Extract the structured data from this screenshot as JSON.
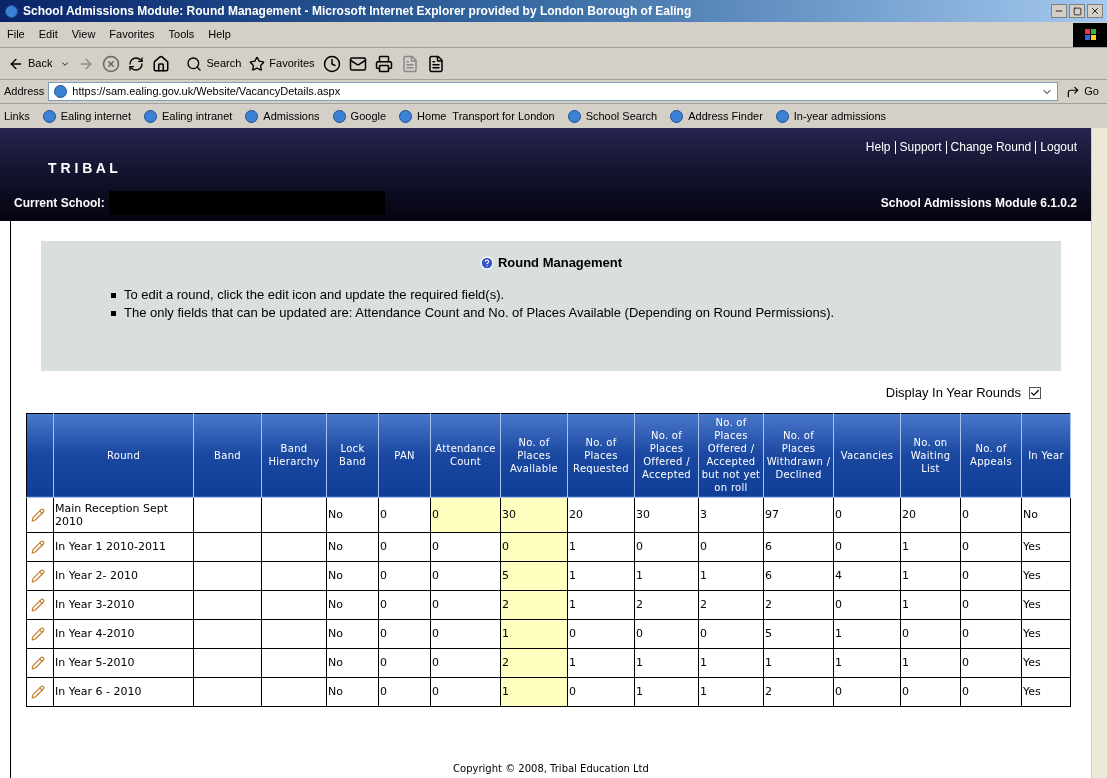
{
  "window": {
    "title": "School Admissions Module: Round Management - Microsoft Internet Explorer provided by London Borough of Ealing"
  },
  "menu": [
    "File",
    "Edit",
    "View",
    "Favorites",
    "Tools",
    "Help"
  ],
  "toolbar": {
    "back": "Back",
    "search": "Search",
    "favorites": "Favorites"
  },
  "address": {
    "label": "Address",
    "url": "https://sam.ealing.gov.uk/Website/VacancyDetails.aspx",
    "go": "Go"
  },
  "links": {
    "label": "Links",
    "items": [
      "Ealing internet",
      "Ealing intranet",
      "Admissions",
      "Google",
      "Home  Transport for London",
      "School Search",
      "Address Finder",
      "In-year admissions"
    ]
  },
  "header": {
    "logo": "T R I B A L",
    "nav": [
      "Help",
      "Support",
      "Change Round",
      "Logout"
    ],
    "current_school_label": "Current School:",
    "module": "School Admissions Module 6.1.0.2"
  },
  "info": {
    "title": "Round Management",
    "bullets": [
      "To edit a round, click the edit icon and update the required field(s).",
      "The only fields that can be updated are: Attendance Count and No. of Places Available (Depending on Round Permissions)."
    ]
  },
  "display_in_year": {
    "label": "Display In Year Rounds",
    "checked": true
  },
  "table": {
    "columns": [
      "Round",
      "Band",
      "Band Hierarchy",
      "Lock Band",
      "PAN",
      "Attendance Count",
      "No. of Places Available",
      "No. of Places Requested",
      "No. of Places Offered / Accepted",
      "No. of Places Offered / Accepted but not yet on roll",
      "No. of Places Withdrawn / Declined",
      "Vacancies",
      "No. on Waiting List",
      "No. of Appeals",
      "In Year"
    ],
    "rows": [
      {
        "cells": [
          {
            "text": "Main Reception Sept 2010",
            "highlighted": false
          },
          {
            "text": "",
            "highlighted": false
          },
          {
            "text": "",
            "highlighted": false
          },
          {
            "text": "No",
            "highlighted": false
          },
          {
            "text": "0",
            "highlighted": false
          },
          {
            "text": "0",
            "highlighted": true
          },
          {
            "text": "30",
            "highlighted": true
          },
          {
            "text": "20",
            "highlighted": false
          },
          {
            "text": "30",
            "highlighted": false
          },
          {
            "text": "3",
            "highlighted": false
          },
          {
            "text": "97",
            "highlighted": false
          },
          {
            "text": "0",
            "highlighted": false
          },
          {
            "text": "20",
            "highlighted": false
          },
          {
            "text": "0",
            "highlighted": false
          },
          {
            "text": "No",
            "highlighted": false
          }
        ]
      },
      {
        "cells": [
          {
            "text": "In Year 1 2010-2011",
            "highlighted": false
          },
          {
            "text": "",
            "highlighted": false
          },
          {
            "text": "",
            "highlighted": false
          },
          {
            "text": "No",
            "highlighted": false
          },
          {
            "text": "0",
            "highlighted": false
          },
          {
            "text": "0",
            "highlighted": false
          },
          {
            "text": "0",
            "highlighted": true
          },
          {
            "text": "1",
            "highlighted": false
          },
          {
            "text": "0",
            "highlighted": false
          },
          {
            "text": "0",
            "highlighted": false
          },
          {
            "text": "6",
            "highlighted": false
          },
          {
            "text": "0",
            "highlighted": false
          },
          {
            "text": "1",
            "highlighted": false
          },
          {
            "text": "0",
            "highlighted": false
          },
          {
            "text": "Yes",
            "highlighted": false
          }
        ]
      },
      {
        "cells": [
          {
            "text": "In Year 2- 2010",
            "highlighted": false
          },
          {
            "text": "",
            "highlighted": false
          },
          {
            "text": "",
            "highlighted": false
          },
          {
            "text": "No",
            "highlighted": false
          },
          {
            "text": "0",
            "highlighted": false
          },
          {
            "text": "0",
            "highlighted": false
          },
          {
            "text": "5",
            "highlighted": true
          },
          {
            "text": "1",
            "highlighted": false
          },
          {
            "text": "1",
            "highlighted": false
          },
          {
            "text": "1",
            "highlighted": false
          },
          {
            "text": "6",
            "highlighted": false
          },
          {
            "text": "4",
            "highlighted": false
          },
          {
            "text": "1",
            "highlighted": false
          },
          {
            "text": "0",
            "highlighted": false
          },
          {
            "text": "Yes",
            "highlighted": false
          }
        ]
      },
      {
        "cells": [
          {
            "text": "In Year 3-2010",
            "highlighted": false
          },
          {
            "text": "",
            "highlighted": false
          },
          {
            "text": "",
            "highlighted": false
          },
          {
            "text": "No",
            "highlighted": false
          },
          {
            "text": "0",
            "highlighted": false
          },
          {
            "text": "0",
            "highlighted": false
          },
          {
            "text": "2",
            "highlighted": true
          },
          {
            "text": "1",
            "highlighted": false
          },
          {
            "text": "2",
            "highlighted": false
          },
          {
            "text": "2",
            "highlighted": false
          },
          {
            "text": "2",
            "highlighted": false
          },
          {
            "text": "0",
            "highlighted": false
          },
          {
            "text": "1",
            "highlighted": false
          },
          {
            "text": "0",
            "highlighted": false
          },
          {
            "text": "Yes",
            "highlighted": false
          }
        ]
      },
      {
        "cells": [
          {
            "text": "In Year 4-2010",
            "highlighted": false
          },
          {
            "text": "",
            "highlighted": false
          },
          {
            "text": "",
            "highlighted": false
          },
          {
            "text": "No",
            "highlighted": false
          },
          {
            "text": "0",
            "highlighted": false
          },
          {
            "text": "0",
            "highlighted": false
          },
          {
            "text": "1",
            "highlighted": true
          },
          {
            "text": "0",
            "highlighted": false
          },
          {
            "text": "0",
            "highlighted": false
          },
          {
            "text": "0",
            "highlighted": false
          },
          {
            "text": "5",
            "highlighted": false
          },
          {
            "text": "1",
            "highlighted": false
          },
          {
            "text": "0",
            "highlighted": false
          },
          {
            "text": "0",
            "highlighted": false
          },
          {
            "text": "Yes",
            "highlighted": false
          }
        ]
      },
      {
        "cells": [
          {
            "text": "In Year 5-2010",
            "highlighted": false
          },
          {
            "text": "",
            "highlighted": false
          },
          {
            "text": "",
            "highlighted": false
          },
          {
            "text": "No",
            "highlighted": false
          },
          {
            "text": "0",
            "highlighted": false
          },
          {
            "text": "0",
            "highlighted": false
          },
          {
            "text": "2",
            "highlighted": true
          },
          {
            "text": "1",
            "highlighted": false
          },
          {
            "text": "1",
            "highlighted": false
          },
          {
            "text": "1",
            "highlighted": false
          },
          {
            "text": "1",
            "highlighted": false
          },
          {
            "text": "1",
            "highlighted": false
          },
          {
            "text": "1",
            "highlighted": false
          },
          {
            "text": "0",
            "highlighted": false
          },
          {
            "text": "Yes",
            "highlighted": false
          }
        ]
      },
      {
        "cells": [
          {
            "text": "In Year 6 - 2010",
            "highlighted": false
          },
          {
            "text": "",
            "highlighted": false
          },
          {
            "text": "",
            "highlighted": false
          },
          {
            "text": "No",
            "highlighted": false
          },
          {
            "text": "0",
            "highlighted": false
          },
          {
            "text": "0",
            "highlighted": false
          },
          {
            "text": "1",
            "highlighted": true
          },
          {
            "text": "0",
            "highlighted": false
          },
          {
            "text": "1",
            "highlighted": false
          },
          {
            "text": "1",
            "highlighted": false
          },
          {
            "text": "2",
            "highlighted": false
          },
          {
            "text": "0",
            "highlighted": false
          },
          {
            "text": "0",
            "highlighted": false
          },
          {
            "text": "0",
            "highlighted": false
          },
          {
            "text": "Yes",
            "highlighted": false
          }
        ]
      }
    ]
  },
  "footer": "Copyright © 2008, Tribal Education Ltd"
}
